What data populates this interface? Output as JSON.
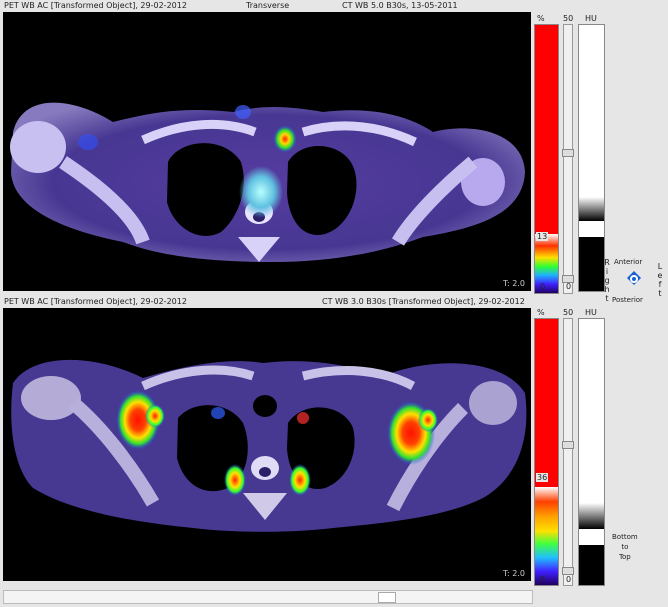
{
  "panels": [
    {
      "header_left": "PET WB AC [Transformed Object], 29-02-2012",
      "header_center": "Transverse",
      "header_right": "CT WB  5.0  B30s, 13-05-2011",
      "t_label": "T: 2.0",
      "pct_label": "%",
      "pct_max": "50",
      "pct_threshold": "13",
      "pct_zero": "0",
      "hu_label": "HU",
      "slider_zero": "0"
    },
    {
      "header_left": "PET WB AC [Transformed Object], 29-02-2012",
      "header_center": "",
      "header_right": "CT WB  3.0  B30s [Transformed Object], 29-02-2012",
      "t_label": "T: 2.0",
      "pct_label": "%",
      "pct_max": "50",
      "pct_threshold": "36",
      "pct_zero": "0",
      "hu_label": "HU",
      "slider_zero": "0"
    }
  ],
  "orientation": {
    "anterior": "Anterior",
    "posterior": "Posterior",
    "right_letters": [
      "R",
      "i",
      "g",
      "h",
      "t"
    ],
    "left_letters": [
      "L",
      "e",
      "f",
      "t"
    ],
    "bottom_to_top": [
      "Bottom",
      "to",
      "Top"
    ]
  },
  "colors": {
    "pet_high": "#ff0000",
    "viewport_bg": "#000000",
    "ui_bg": "#e6e6e6"
  }
}
